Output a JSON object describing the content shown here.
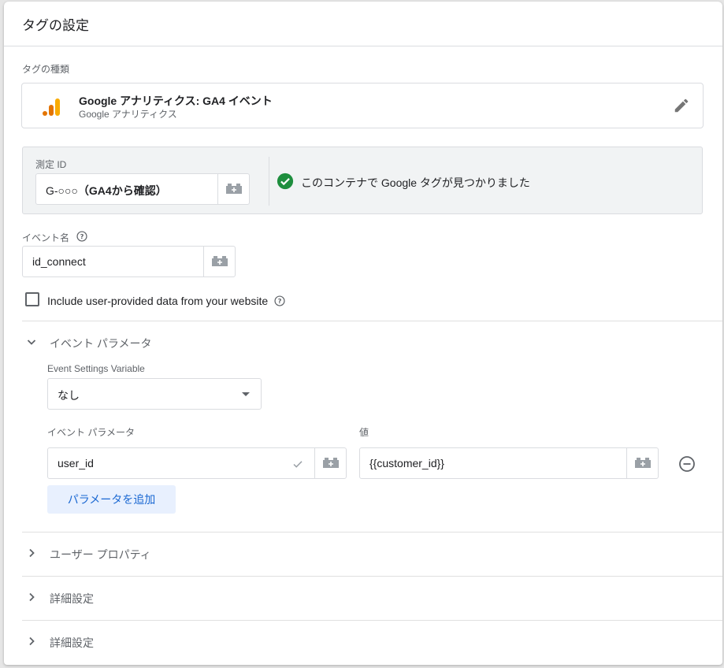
{
  "card": {
    "title": "タグの設定"
  },
  "tag_type": {
    "label": "タグの種類",
    "name": "Google アナリティクス: GA4 イベント",
    "sub": "Google アナリティクス",
    "logo_icon": "google-analytics-icon",
    "edit_icon": "pencil-icon"
  },
  "measurement": {
    "label": "測定 ID",
    "value_prefix": "G-○○○",
    "value_note": "（GA4から確認）",
    "status": "このコンテナで Google タグが見つかりました",
    "status_icon": "check-circle-icon"
  },
  "event_name": {
    "label": "イベント名",
    "value": "id_connect"
  },
  "user_data": {
    "label": "Include user-provided data from your website",
    "checked": false
  },
  "event_params": {
    "heading": "イベント パラメータ",
    "settings_var_label": "Event Settings Variable",
    "settings_var_value": "なし",
    "param_col_label": "イベント パラメータ",
    "value_col_label": "値",
    "rows": [
      {
        "param": "user_id",
        "value": "{{customer_id}}"
      }
    ],
    "add_label": "パラメータを追加"
  },
  "sections": [
    {
      "heading": "ユーザー プロパティ"
    },
    {
      "heading": "詳細設定"
    },
    {
      "heading": "詳細設定"
    }
  ],
  "colors": {
    "accent": "#1967d2",
    "success": "#1e8e3e",
    "ga_orange": "#f9ab00",
    "ga_dark": "#e37400"
  }
}
